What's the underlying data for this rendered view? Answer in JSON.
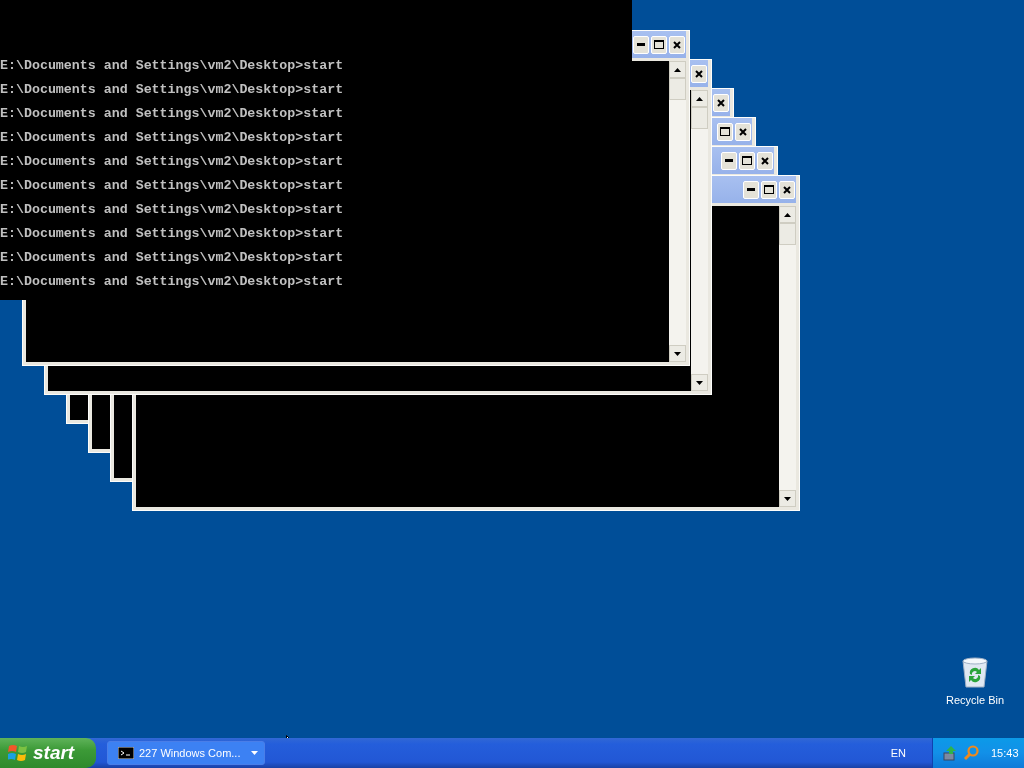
{
  "console": {
    "lines": [
      "E:\\Documents and Settings\\vm2\\Desktop>start",
      "E:\\Documents and Settings\\vm2\\Desktop>start",
      "E:\\Documents and Settings\\vm2\\Desktop>start",
      "E:\\Documents and Settings\\vm2\\Desktop>start",
      "E:\\Documents and Settings\\vm2\\Desktop>start",
      "E:\\Documents and Settings\\vm2\\Desktop>start",
      "E:\\Documents and Settings\\vm2\\Desktop>start",
      "E:\\Documents and Settings\\vm2\\Desktop>start",
      "E:\\Documents and Settings\\vm2\\Desktop>start",
      "E:\\Documents and Settings\\vm2\\Desktop>start"
    ]
  },
  "windows": [
    {
      "active": false,
      "buttons": [
        {
          "kind": "minimize"
        },
        {
          "kind": "maximize"
        },
        {
          "kind": "close"
        }
      ]
    },
    {
      "active": false,
      "buttons": [
        {
          "kind": "close"
        }
      ]
    },
    {
      "active": false,
      "buttons": [
        {
          "kind": "close"
        }
      ]
    },
    {
      "active": false,
      "buttons": [
        {
          "kind": "maximize"
        },
        {
          "kind": "close"
        }
      ]
    },
    {
      "active": false,
      "buttons": [
        {
          "kind": "minimize"
        },
        {
          "kind": "maximize"
        },
        {
          "kind": "close"
        }
      ]
    },
    {
      "active": false,
      "buttons": [
        {
          "kind": "minimize"
        },
        {
          "kind": "maximize"
        },
        {
          "kind": "close"
        }
      ]
    }
  ],
  "desktop_icons": [
    {
      "label": "Recycle Bin"
    }
  ],
  "taskbar": {
    "start_label": "start",
    "tasks": [
      {
        "label": "227 Windows Com...",
        "selected": false
      }
    ],
    "language": "EN",
    "clock": "15:43"
  }
}
